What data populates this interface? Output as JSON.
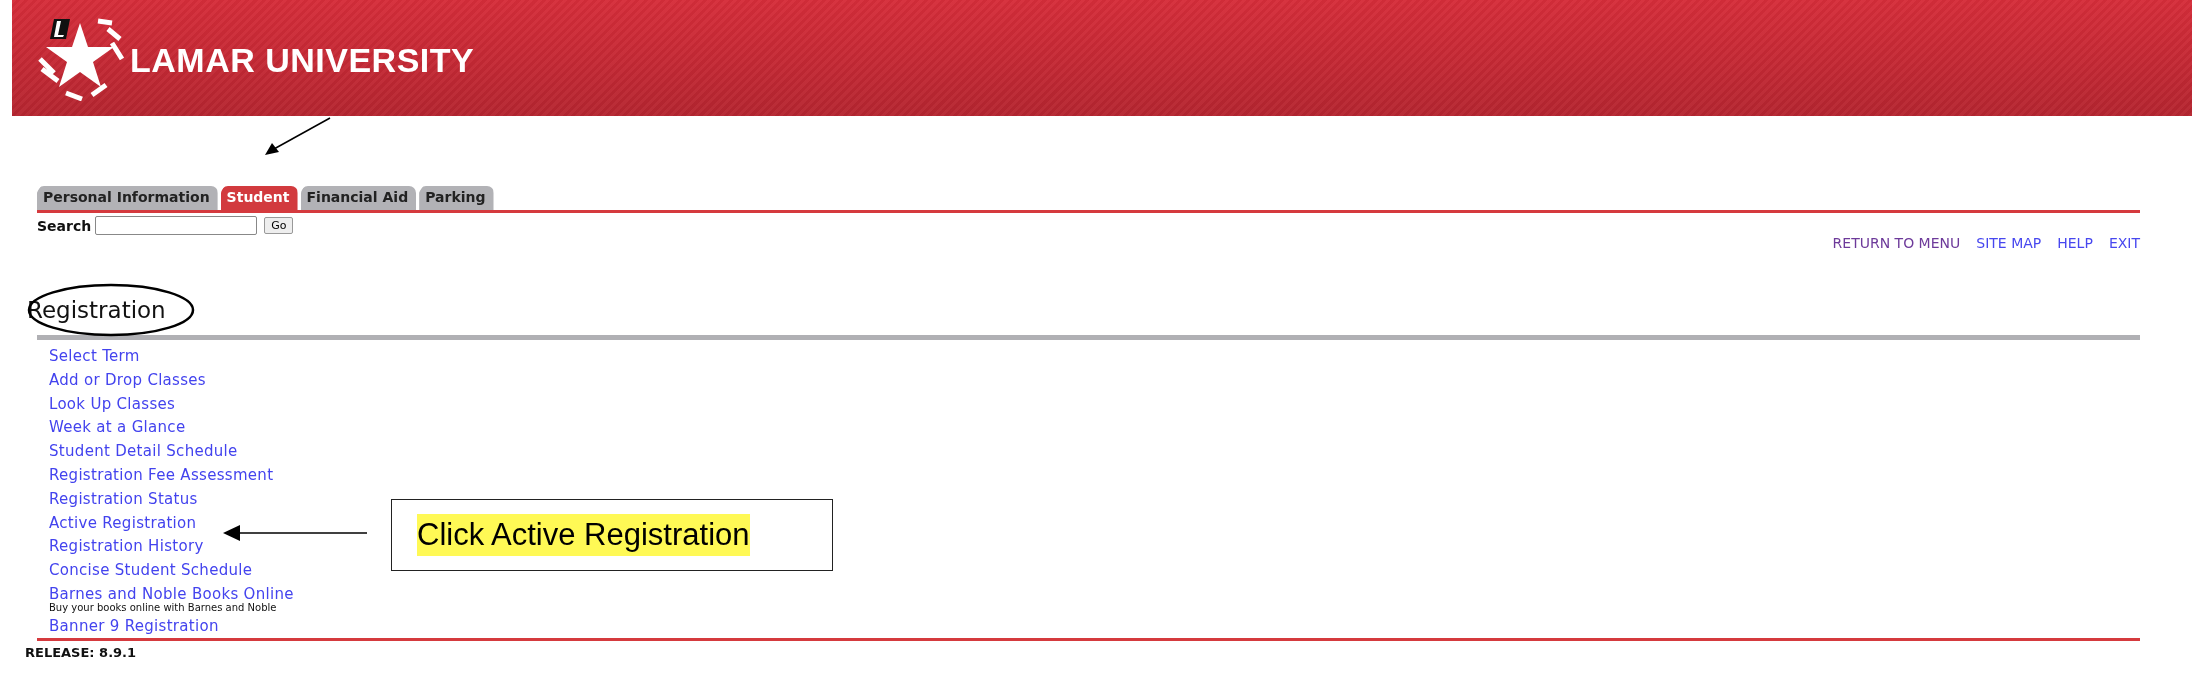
{
  "header": {
    "title": "LAMAR UNIVERSITY"
  },
  "tabs": [
    {
      "label": "Personal Information",
      "selected": false
    },
    {
      "label": "Student",
      "selected": true
    },
    {
      "label": "Financial Aid",
      "selected": false
    },
    {
      "label": "Parking",
      "selected": false
    }
  ],
  "search": {
    "label": "Search",
    "button": "Go"
  },
  "top_links": [
    {
      "label": "RETURN TO MENU",
      "visited": true
    },
    {
      "label": "SITE MAP",
      "visited": false
    },
    {
      "label": "HELP",
      "visited": false
    },
    {
      "label": "EXIT",
      "visited": false
    }
  ],
  "page_title": "Registration",
  "menu": [
    {
      "label": "Select Term"
    },
    {
      "label": "Add or Drop Classes"
    },
    {
      "label": "Look Up Classes"
    },
    {
      "label": "Week at a Glance"
    },
    {
      "label": "Student Detail Schedule"
    },
    {
      "label": "Registration Fee Assessment"
    },
    {
      "label": "Registration Status"
    },
    {
      "label": "Active Registration"
    },
    {
      "label": "Registration History"
    },
    {
      "label": "Concise Student Schedule"
    },
    {
      "label": "Barnes and Noble Books Online",
      "description": "Buy your books online with Barnes and Noble"
    },
    {
      "label": "Banner 9 Registration"
    }
  ],
  "release": "RELEASE: 8.9.1",
  "annotation": {
    "callout": "Click Active Registration"
  }
}
